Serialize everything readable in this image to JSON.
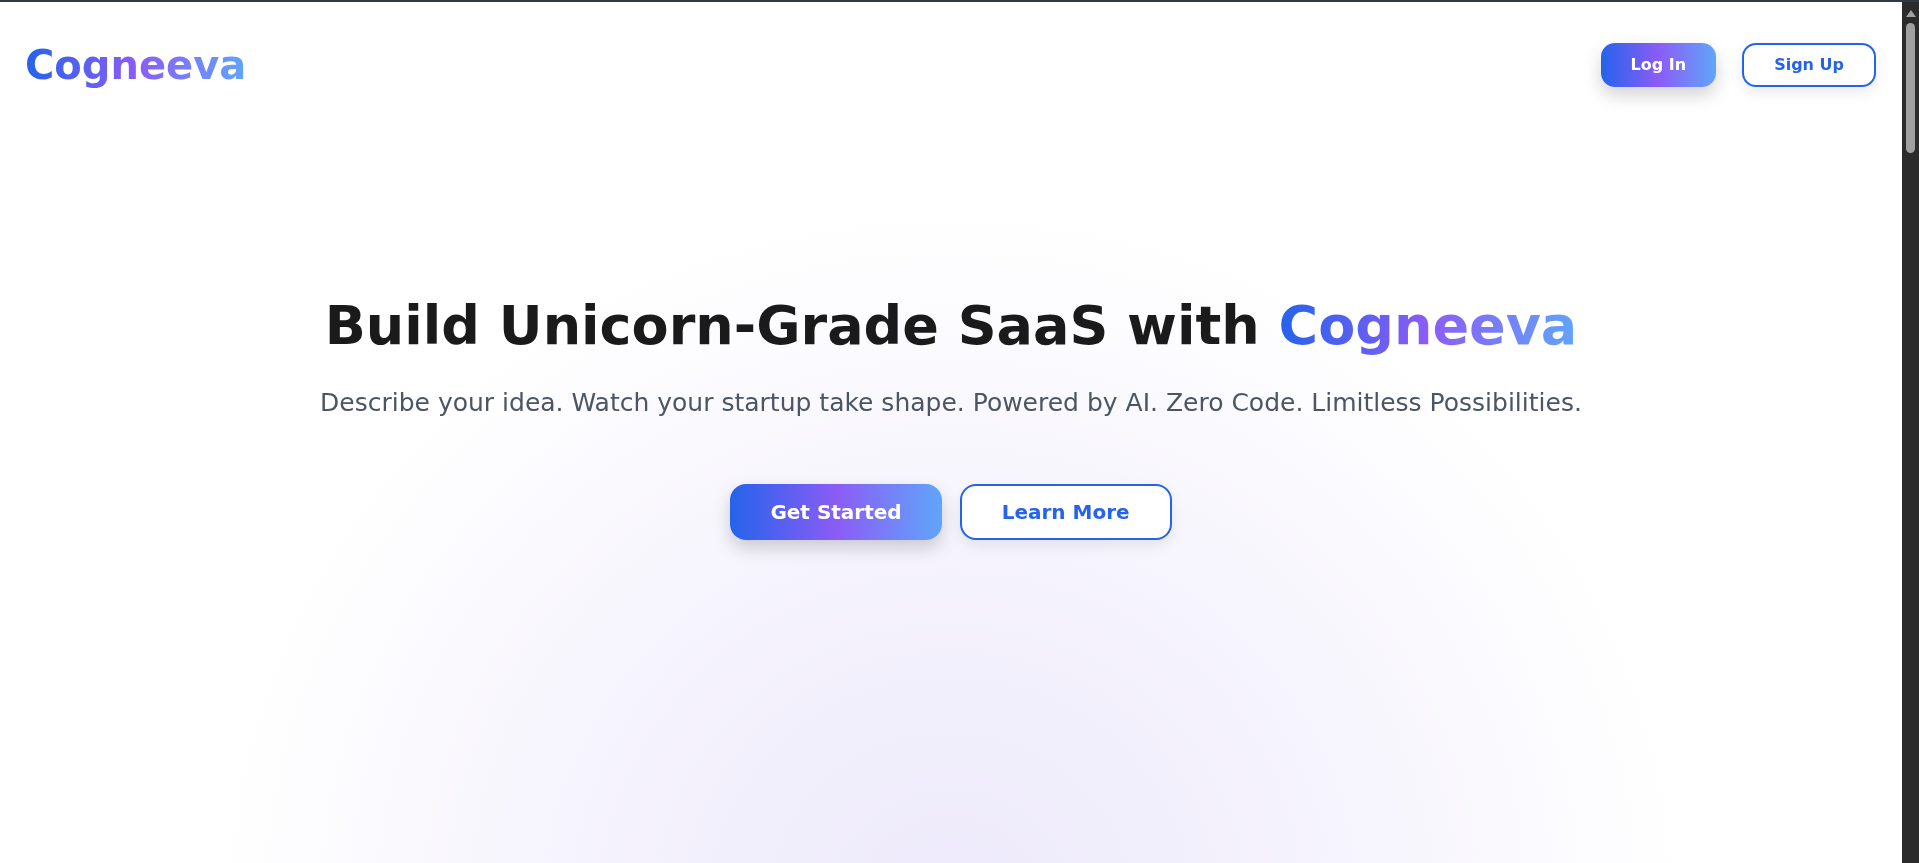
{
  "header": {
    "logo": "Cogneeva",
    "buttons": [
      {
        "label": "Log In",
        "kind": "primary"
      },
      {
        "label": "Sign Up",
        "kind": "outline"
      }
    ]
  },
  "hero": {
    "title": "Build Unicorn-Grade SaaS with",
    "title_highlight": "Cogneeva",
    "subtitle": "Describe your idea. Watch your startup take shape. Powered by AI. Zero Code. Limitless Possibilities.",
    "buttons": [
      {
        "label": "Get Started",
        "kind": "primary"
      },
      {
        "label": "Learn More",
        "kind": "outline"
      }
    ]
  }
}
